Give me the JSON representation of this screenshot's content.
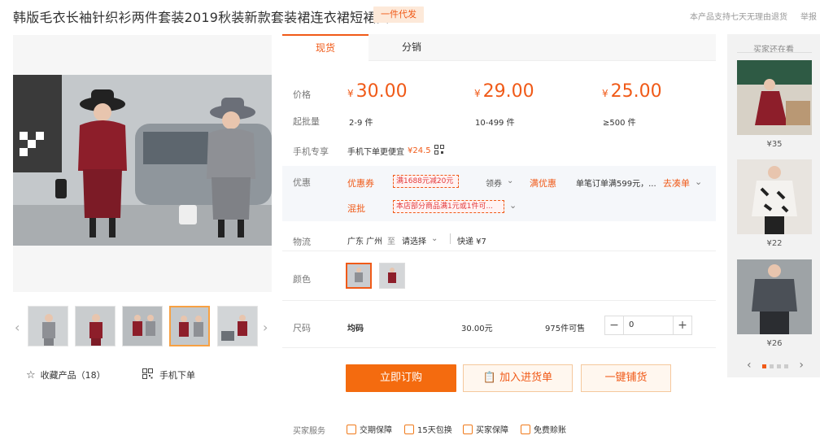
{
  "header": {
    "title": "韩版毛衣长袖针织衫两件套装2019秋装新款套装裙连衣裙短裙女",
    "badge": "一件代发",
    "notice": "本产品支持七天无理由退货",
    "report": "举报"
  },
  "tabs": [
    {
      "label": "现货",
      "active": true
    },
    {
      "label": "分销",
      "active": false
    }
  ],
  "price": {
    "price_label": "价格",
    "moq_label": "起批量",
    "tiers": [
      {
        "currency": "¥",
        "value": "30.00",
        "range": "2-9 件"
      },
      {
        "currency": "¥",
        "value": "29.00",
        "range": "10-499 件"
      },
      {
        "currency": "¥",
        "value": "25.00",
        "range": "≥500 件"
      }
    ]
  },
  "mobile": {
    "label": "手机专享",
    "text": "手机下单更便宜",
    "price": "¥24.5"
  },
  "promo": {
    "label": "优惠",
    "coupon_label": "优惠券",
    "coupon_tag": "满1688元减20元",
    "coupon_action": "领券",
    "full_label": "满优惠",
    "full_text": "单笔订单满599元，...",
    "full_action": "去凑单",
    "mix_label": "混批",
    "mix_tag": "本店部分商品满1元或1件可..."
  },
  "logistics": {
    "label": "物流",
    "from": "广东 广州",
    "to_word": "至",
    "to": "请选择",
    "express": "快递 ¥7"
  },
  "color": {
    "label": "颜色",
    "options": [
      "grey",
      "red"
    ]
  },
  "size": {
    "label": "尺码",
    "value": "均码",
    "price": "30.00元",
    "stock": "975件可售",
    "qty": "0"
  },
  "actions": {
    "order": "立即订购",
    "cart": "加入进货单",
    "distribute": "一键铺货"
  },
  "services": {
    "label": "买家服务",
    "items": [
      "交期保障",
      "15天包换",
      "买家保障",
      "免费赊账"
    ]
  },
  "gallery": {
    "favorite": "收藏产品（18）",
    "mobile_order": "手机下单"
  },
  "side": {
    "title": "买家还在看",
    "items": [
      {
        "price": "¥35"
      },
      {
        "price": "¥22"
      },
      {
        "price": "¥26"
      }
    ]
  },
  "colors": {
    "accent": "#f05a18",
    "order_button": "#f46b0f"
  }
}
